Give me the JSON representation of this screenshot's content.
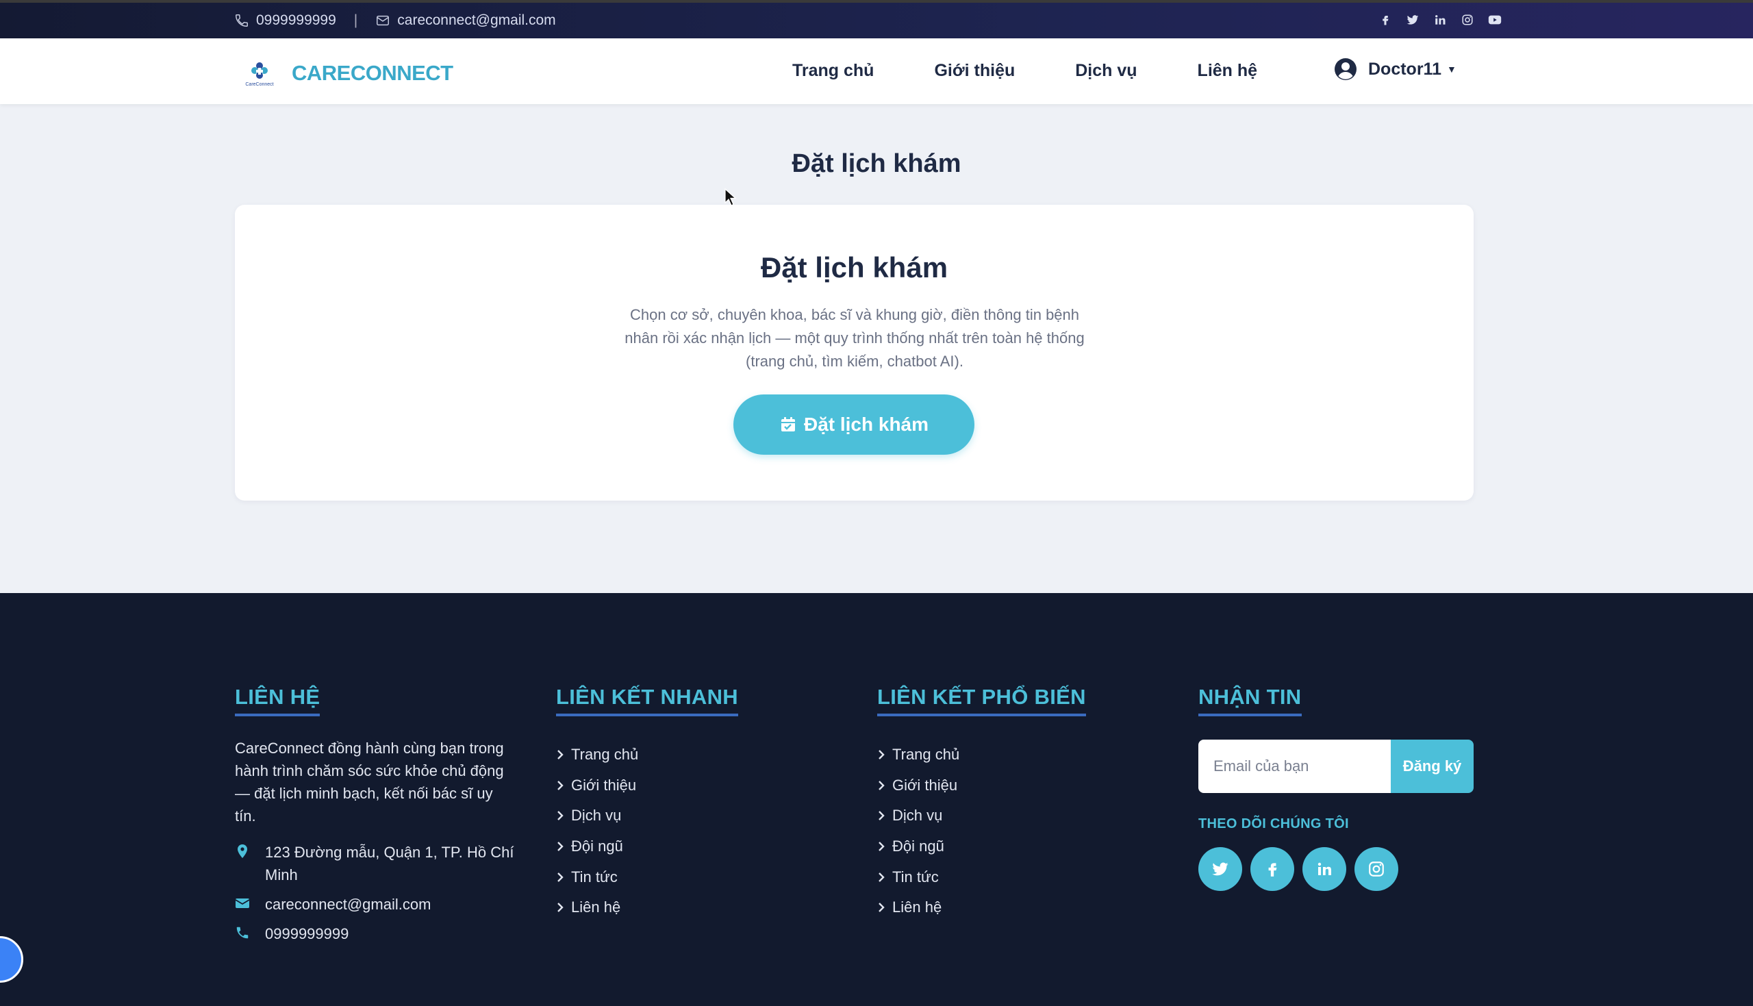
{
  "topbar": {
    "phone": "0999999999",
    "separator": "|",
    "email": "careconnect@gmail.com",
    "social_icons": [
      "facebook-icon",
      "twitter-icon",
      "linkedin-icon",
      "instagram-icon",
      "youtube-icon"
    ]
  },
  "header": {
    "logo_text": "CARECONNECT",
    "nav": [
      "Trang chủ",
      "Giới thiệu",
      "Dịch vụ",
      "Liên hệ"
    ],
    "user_name": "Doctor11"
  },
  "main": {
    "page_title": "Đặt lịch khám",
    "card_title": "Đặt lịch khám",
    "card_description": "Chọn cơ sở, chuyên khoa, bác sĩ và khung giờ, điền thông tin bệnh nhân rồi xác nhận lịch — một quy trình thống nhất trên toàn hệ thống (trang chủ, tìm kiếm, chatbot AI).",
    "book_button": "Đặt lịch khám"
  },
  "footer": {
    "contact": {
      "heading": "LIÊN HỆ",
      "description": "CareConnect đồng hành cùng bạn trong hành trình chăm sóc sức khỏe chủ động — đặt lịch minh bạch, kết nối bác sĩ uy tín.",
      "address": "123 Đường mẫu, Quận 1, TP. Hồ Chí Minh",
      "email": "careconnect@gmail.com",
      "phone": "0999999999"
    },
    "quick_links": {
      "heading": "LIÊN KẾT NHANH",
      "items": [
        "Trang chủ",
        "Giới thiệu",
        "Dịch vụ",
        "Đội ngũ",
        "Tin tức",
        "Liên hệ"
      ]
    },
    "popular_links": {
      "heading": "LIÊN KẾT PHỔ BIẾN",
      "items": [
        "Trang chủ",
        "Giới thiệu",
        "Dịch vụ",
        "Đội ngũ",
        "Tin tức",
        "Liên hệ"
      ]
    },
    "newsletter": {
      "heading": "NHẬN TIN",
      "placeholder": "Email của bạn",
      "button": "Đăng ký",
      "follow_label": "THEO DÕI CHÚNG TÔI",
      "social_icons": [
        "twitter-icon",
        "facebook-icon",
        "linkedin-icon",
        "instagram-icon"
      ]
    }
  },
  "colors": {
    "accent": "#4cbfd9",
    "brand": "#3aa8c9",
    "footer_bg": "#121a2e",
    "text_dark": "#1f2a44"
  }
}
